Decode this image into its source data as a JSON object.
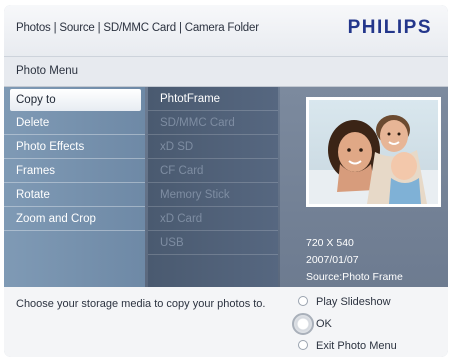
{
  "header": {
    "breadcrumb": "Photos | Source | SD/MMC Card | Camera Folder",
    "brand": "PHILIPS"
  },
  "menu": {
    "title": "Photo Menu",
    "items": [
      {
        "label": "Copy to",
        "selected": true
      },
      {
        "label": "Delete"
      },
      {
        "label": "Photo Effects"
      },
      {
        "label": "Frames"
      },
      {
        "label": "Rotate"
      },
      {
        "label": "Zoom and Crop"
      }
    ]
  },
  "destinations": [
    {
      "label": "PhtotFrame",
      "enabled": true
    },
    {
      "label": "SD/MMC Card",
      "enabled": false
    },
    {
      "label": "xD SD",
      "enabled": false
    },
    {
      "label": "CF Card",
      "enabled": false
    },
    {
      "label": "Memory Stick",
      "enabled": false
    },
    {
      "label": "xD Card",
      "enabled": false
    },
    {
      "label": "USB",
      "enabled": false
    }
  ],
  "photo": {
    "resolution": "720 X 540",
    "date": "2007/01/07",
    "source": "Source:Photo Frame"
  },
  "footer": {
    "hint": "Choose your storage media to copy your photos to.",
    "options": [
      {
        "label": "Play Slideshow"
      },
      {
        "label": "OK"
      },
      {
        "label": "Exit Photo Menu"
      }
    ]
  },
  "colors": {
    "brand": "#23368b",
    "menu_panel": "#7f9ab5",
    "submenu_panel": "#4a5a70"
  }
}
